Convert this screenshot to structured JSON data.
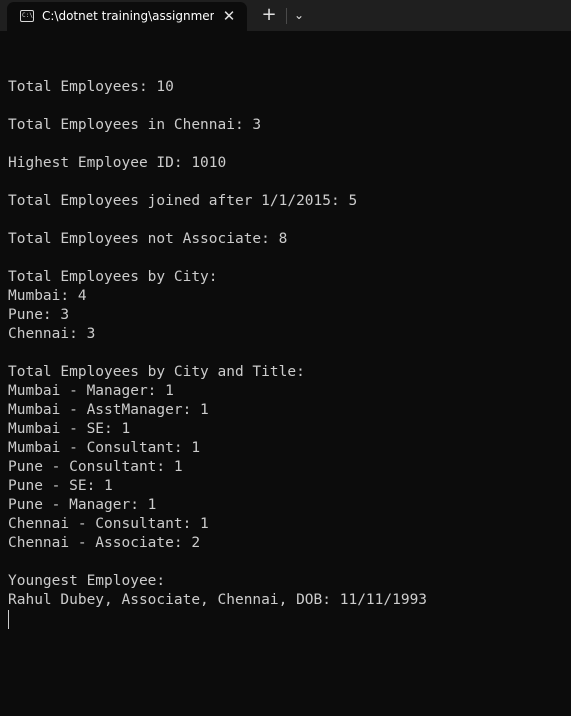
{
  "tab": {
    "icon_label": "C:\\",
    "title": "C:\\dotnet training\\assignmen",
    "close_glyph": "✕",
    "new_tab_glyph": "+",
    "dropdown_glyph": "⌄"
  },
  "console": {
    "lines": [
      "",
      "Total Employees: 10",
      "",
      "Total Employees in Chennai: 3",
      "",
      "Highest Employee ID: 1010",
      "",
      "Total Employees joined after 1/1/2015: 5",
      "",
      "Total Employees not Associate: 8",
      "",
      "Total Employees by City:",
      "Mumbai: 4",
      "Pune: 3",
      "Chennai: 3",
      "",
      "Total Employees by City and Title:",
      "Mumbai - Manager: 1",
      "Mumbai - AsstManager: 1",
      "Mumbai - SE: 1",
      "Mumbai - Consultant: 1",
      "Pune - Consultant: 1",
      "Pune - SE: 1",
      "Pune - Manager: 1",
      "Chennai - Consultant: 1",
      "Chennai - Associate: 2",
      "",
      "Youngest Employee:",
      "Rahul Dubey, Associate, Chennai, DOB: 11/11/1993"
    ]
  }
}
